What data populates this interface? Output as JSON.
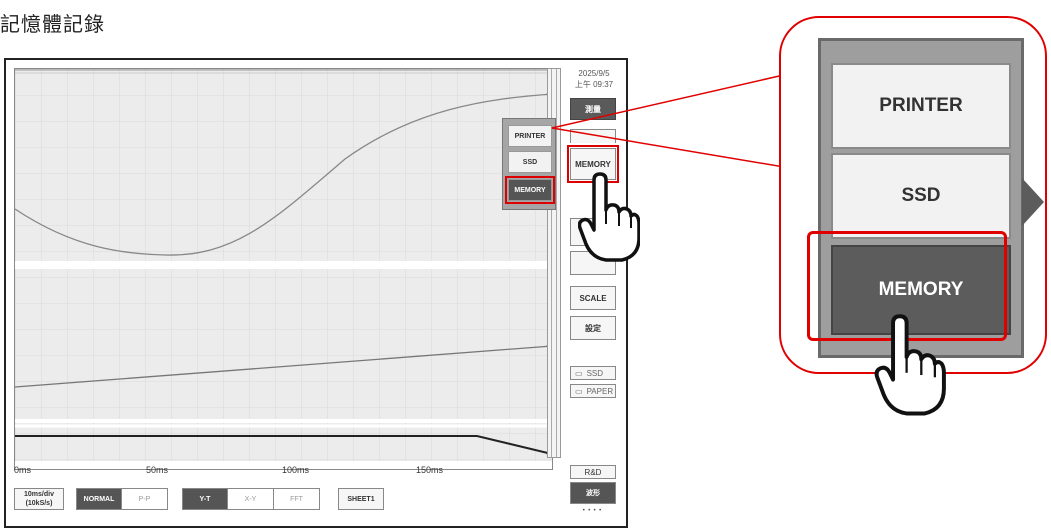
{
  "page_title": "記憶體記錄",
  "screen": {
    "date": "2025/9/5",
    "time": "上午 09:37",
    "right_buttons": {
      "measure": "測量",
      "memory": "MEMORY",
      "scale": "SCALE",
      "settings": "設定",
      "ssd": "SSD",
      "paper": "PAPER",
      "rd": "R&D"
    },
    "menu": [
      "PRINTER",
      "SSD",
      "MEMORY"
    ],
    "time_axis": [
      "0ms",
      "50ms",
      "100ms",
      "150ms"
    ],
    "bottom": {
      "timebase": "10ms/div",
      "sample_rate": "(10kS/s)",
      "normal": "NORMAL",
      "pp": "P-P",
      "yt": "Y-T",
      "xy": "X-Y",
      "fft": "FFT",
      "sheet": "SHEET1",
      "waveform": "波形",
      "dots": "• • • •"
    }
  },
  "zoom": {
    "items": [
      "PRINTER",
      "SSD",
      "MEMORY"
    ]
  }
}
